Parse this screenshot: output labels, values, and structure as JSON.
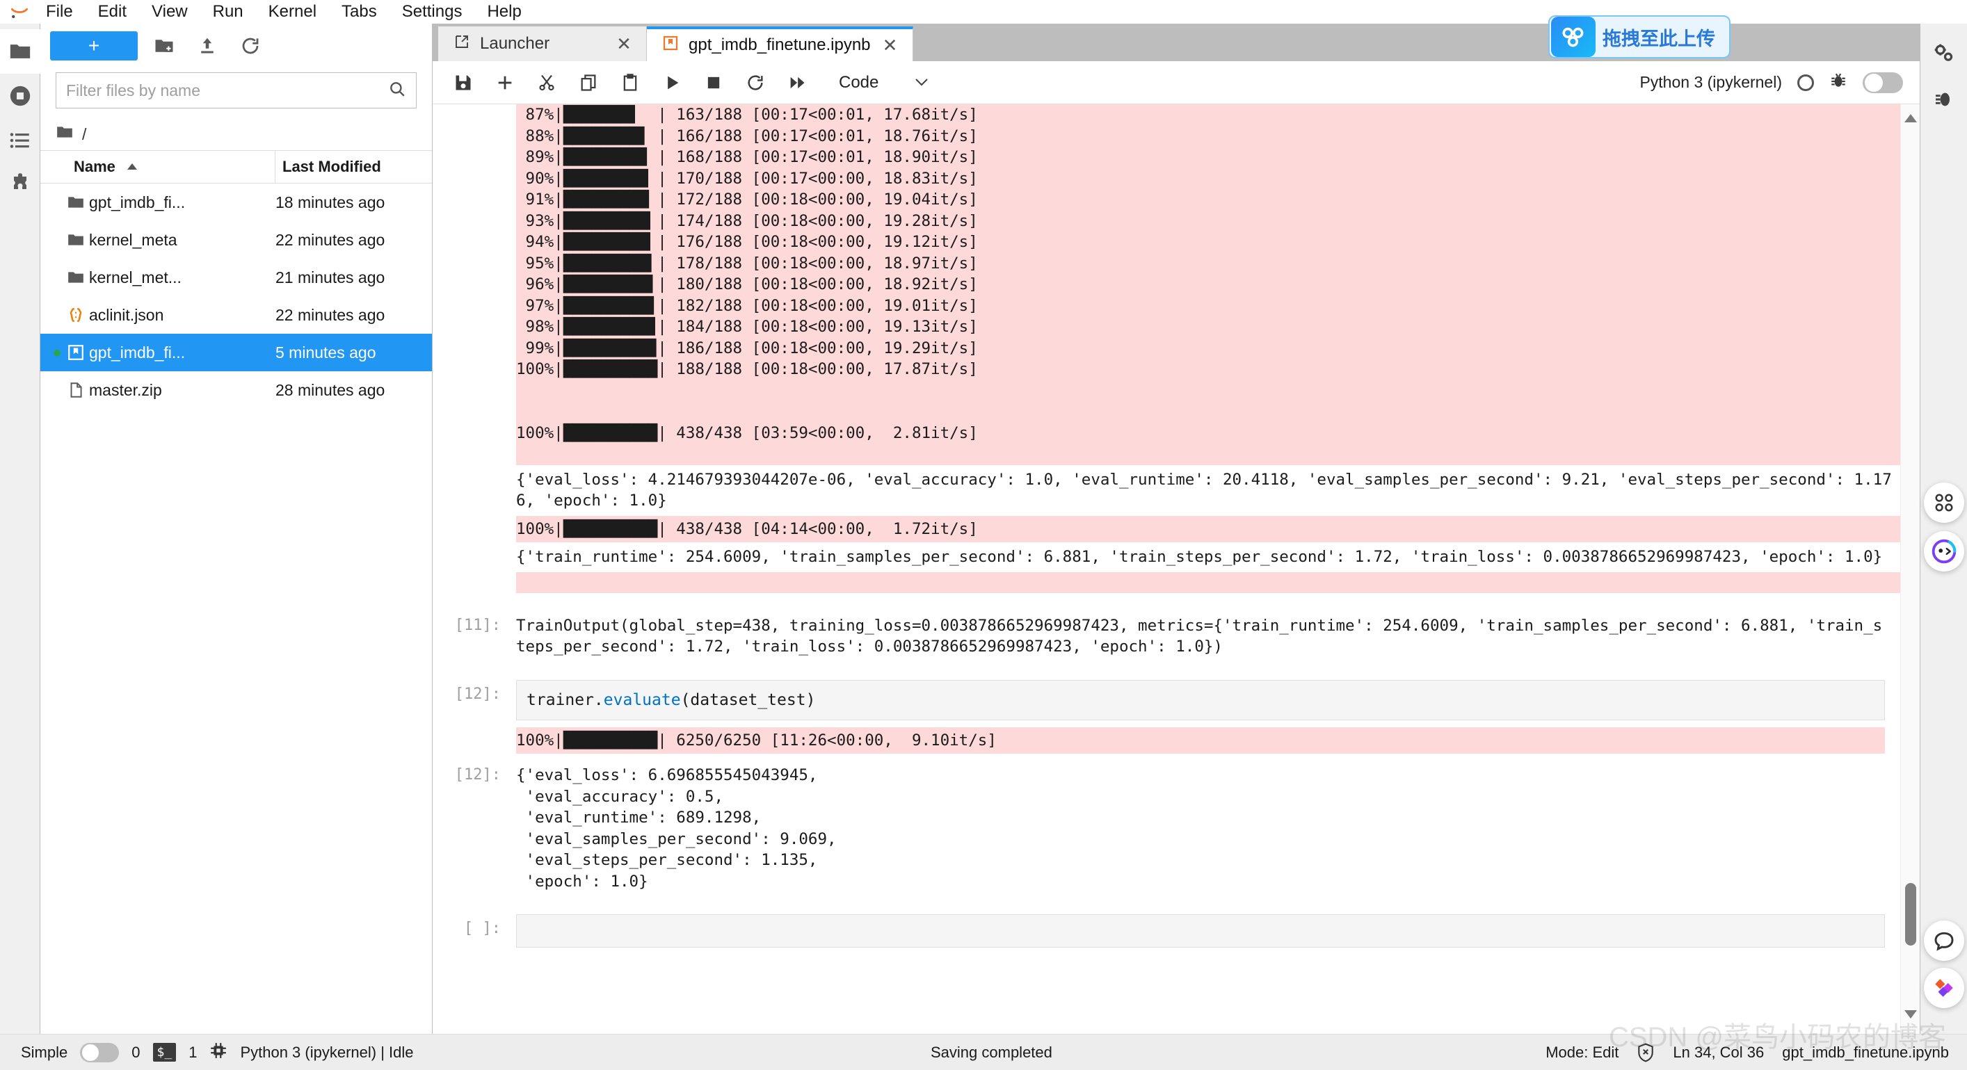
{
  "menubar": {
    "items": [
      "File",
      "Edit",
      "View",
      "Run",
      "Kernel",
      "Tabs",
      "Settings",
      "Help"
    ]
  },
  "upload_widget": {
    "label": "拖拽至此上传"
  },
  "filebrowser": {
    "new_button": "+",
    "filter_placeholder": "Filter files by name",
    "filter_value": "",
    "breadcrumb": "/",
    "columns": {
      "name": "Name",
      "last_modified": "Last Modified"
    },
    "rows": [
      {
        "name": "gpt_imdb_fi...",
        "modified": "18 minutes ago",
        "type": "folder",
        "selected": false,
        "running": false
      },
      {
        "name": "kernel_meta",
        "modified": "22 minutes ago",
        "type": "folder",
        "selected": false,
        "running": false
      },
      {
        "name": "kernel_met...",
        "modified": "21 minutes ago",
        "type": "folder",
        "selected": false,
        "running": false
      },
      {
        "name": "aclinit.json",
        "modified": "22 minutes ago",
        "type": "json",
        "selected": false,
        "running": false
      },
      {
        "name": "gpt_imdb_fi...",
        "modified": "5 minutes ago",
        "type": "notebook",
        "selected": true,
        "running": true
      },
      {
        "name": "master.zip",
        "modified": "28 minutes ago",
        "type": "file",
        "selected": false,
        "running": false
      }
    ]
  },
  "tabs": [
    {
      "label": "Launcher",
      "active": false
    },
    {
      "label": "gpt_imdb_finetune.ipynb",
      "active": true
    }
  ],
  "notebook_toolbar": {
    "cell_type": "Code",
    "kernel_name": "Python 3 (ipykernel)"
  },
  "notebook": {
    "progress_lines": [
      " 87%|███████▋  | 163/188 [00:17<00:01, 17.68it/s]",
      " 88%|████████▋ | 166/188 [00:17<00:01, 18.76it/s]",
      " 89%|████████▉ | 168/188 [00:17<00:01, 18.90it/s]",
      " 90%|█████████ | 170/188 [00:17<00:00, 18.83it/s]",
      " 91%|█████████▏| 172/188 [00:18<00:00, 19.04it/s]",
      " 93%|█████████▎| 174/188 [00:18<00:00, 19.28it/s]",
      " 94%|█████████▎| 176/188 [00:18<00:00, 19.12it/s]",
      " 95%|█████████▍| 178/188 [00:18<00:00, 18.97it/s]",
      " 96%|█████████▌| 180/188 [00:18<00:00, 18.92it/s]",
      " 97%|█████████▋| 182/188 [00:18<00:00, 19.01it/s]",
      " 98%|█████████▊| 184/188 [00:18<00:00, 19.13it/s]",
      " 99%|█████████▉| 186/188 [00:18<00:00, 19.29it/s]",
      "100%|██████████| 188/188 [00:18<00:00, 17.87it/s]"
    ],
    "progress_total_line": "100%|██████████| 438/438 [03:59<00:00,  2.81it/s]",
    "eval_metrics_line": "{'eval_loss': 4.214679393044207e-06, 'eval_accuracy': 1.0, 'eval_runtime': 20.4118, 'eval_samples_per_second': 9.21, 'eval_steps_per_second': 1.176, 'epoch': 1.0}",
    "train_progress_line": "100%|██████████| 438/438 [04:14<00:00,  1.72it/s]",
    "train_metrics_line": "{'train_runtime': 254.6009, 'train_samples_per_second': 6.881, 'train_steps_per_second': 1.72, 'train_loss': 0.0038786652969987423, 'epoch': 1.0}",
    "cell11": {
      "prompt": "[11]:",
      "output": "TrainOutput(global_step=438, training_loss=0.0038786652969987423, metrics={'train_runtime': 254.6009, 'train_samples_per_second': 6.881, 'train_steps_per_second': 1.72, 'train_loss': 0.0038786652969987423, 'epoch': 1.0})"
    },
    "cell12": {
      "prompt": "[12]:",
      "source_prefix": "trainer.",
      "source_keyword": "evaluate",
      "source_suffix": "(dataset_test)",
      "eval_progress_line": "100%|██████████| 6250/6250 [11:26<00:00,  9.10it/s]",
      "out_prompt": "[12]:",
      "output_lines": [
        "{'eval_loss': 6.696855545043945,",
        " 'eval_accuracy': 0.5,",
        " 'eval_runtime': 689.1298,",
        " 'eval_samples_per_second': 9.069,",
        " 'eval_steps_per_second': 1.135,",
        " 'epoch': 1.0}"
      ]
    },
    "cell_empty": {
      "prompt": "[ ]:",
      "source": ""
    }
  },
  "statusbar": {
    "simple_label": "Simple",
    "kernel_count": "0",
    "terminal_badge": "$_",
    "terminal_count": "1",
    "kernel_status": "Python 3 (ipykernel) | Idle",
    "save_status": "Saving completed",
    "mode": "Mode: Edit",
    "cursor": "Ln 34, Col 36",
    "file_name": "gpt_imdb_finetune.ipynb"
  },
  "watermark": "CSDN @菜鸟小码农的博客",
  "colors": {
    "accent": "#2196f3",
    "stderr_bg": "#fdd9d9",
    "selected_row": "#2196f3",
    "input_cell_bg": "#f5f5f5"
  }
}
